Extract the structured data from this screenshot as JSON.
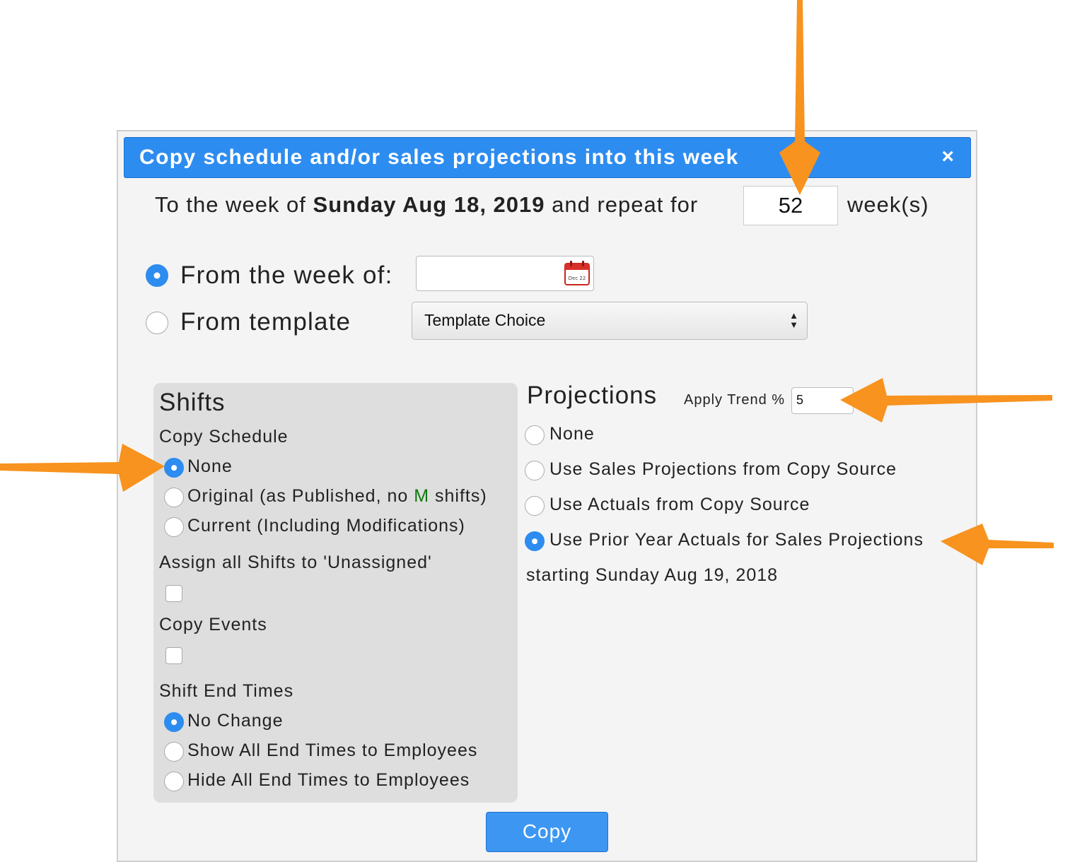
{
  "dialog": {
    "title": "Copy schedule and/or sales projections into this week",
    "close_glyph": "×"
  },
  "target_week": {
    "prefix": "To the week of",
    "date": "Sunday Aug 18, 2019",
    "repeat_text": "and repeat for",
    "repeat_value": "52",
    "suffix": "week(s)"
  },
  "source": {
    "from_week_label": "From the week of:",
    "from_week_selected": true,
    "from_week_value": "",
    "calendar_icon_text": "Dec 22",
    "from_template_label": "From template",
    "template_select_value": "Template Choice"
  },
  "shifts": {
    "heading": "Shifts",
    "copy_schedule_label": "Copy Schedule",
    "copy_schedule_options": [
      {
        "label": "None",
        "selected": true
      },
      {
        "label_before": "Original (as Published, no ",
        "label_highlight": "M",
        "label_after": " shifts)",
        "selected": false
      },
      {
        "label": "Current (Including Modifications)",
        "selected": false
      }
    ],
    "assign_unassigned_label": "Assign all Shifts to 'Unassigned'",
    "assign_unassigned_checked": false,
    "copy_events_label": "Copy Events",
    "copy_events_checked": false,
    "end_times_label": "Shift End Times",
    "end_times_options": [
      {
        "label": "No Change",
        "selected": true
      },
      {
        "label": "Show All End Times to Employees",
        "selected": false
      },
      {
        "label": "Hide All End Times to Employees",
        "selected": false
      }
    ]
  },
  "projections": {
    "heading": "Projections",
    "trend_label": "Apply Trend %",
    "trend_value": "5",
    "options": [
      {
        "label": "None",
        "selected": false
      },
      {
        "label": "Use Sales Projections from Copy Source",
        "selected": false
      },
      {
        "label": "Use Actuals from Copy Source",
        "selected": false
      },
      {
        "label": "Use Prior Year Actuals for Sales Projections",
        "selected": true
      }
    ],
    "starting_text": "starting Sunday Aug 19, 2018"
  },
  "actions": {
    "copy_label": "Copy"
  },
  "colors": {
    "accent": "#2d8cf0",
    "annotation_arrow": "#f7931e",
    "highlight_green": "#0f7a0f"
  }
}
